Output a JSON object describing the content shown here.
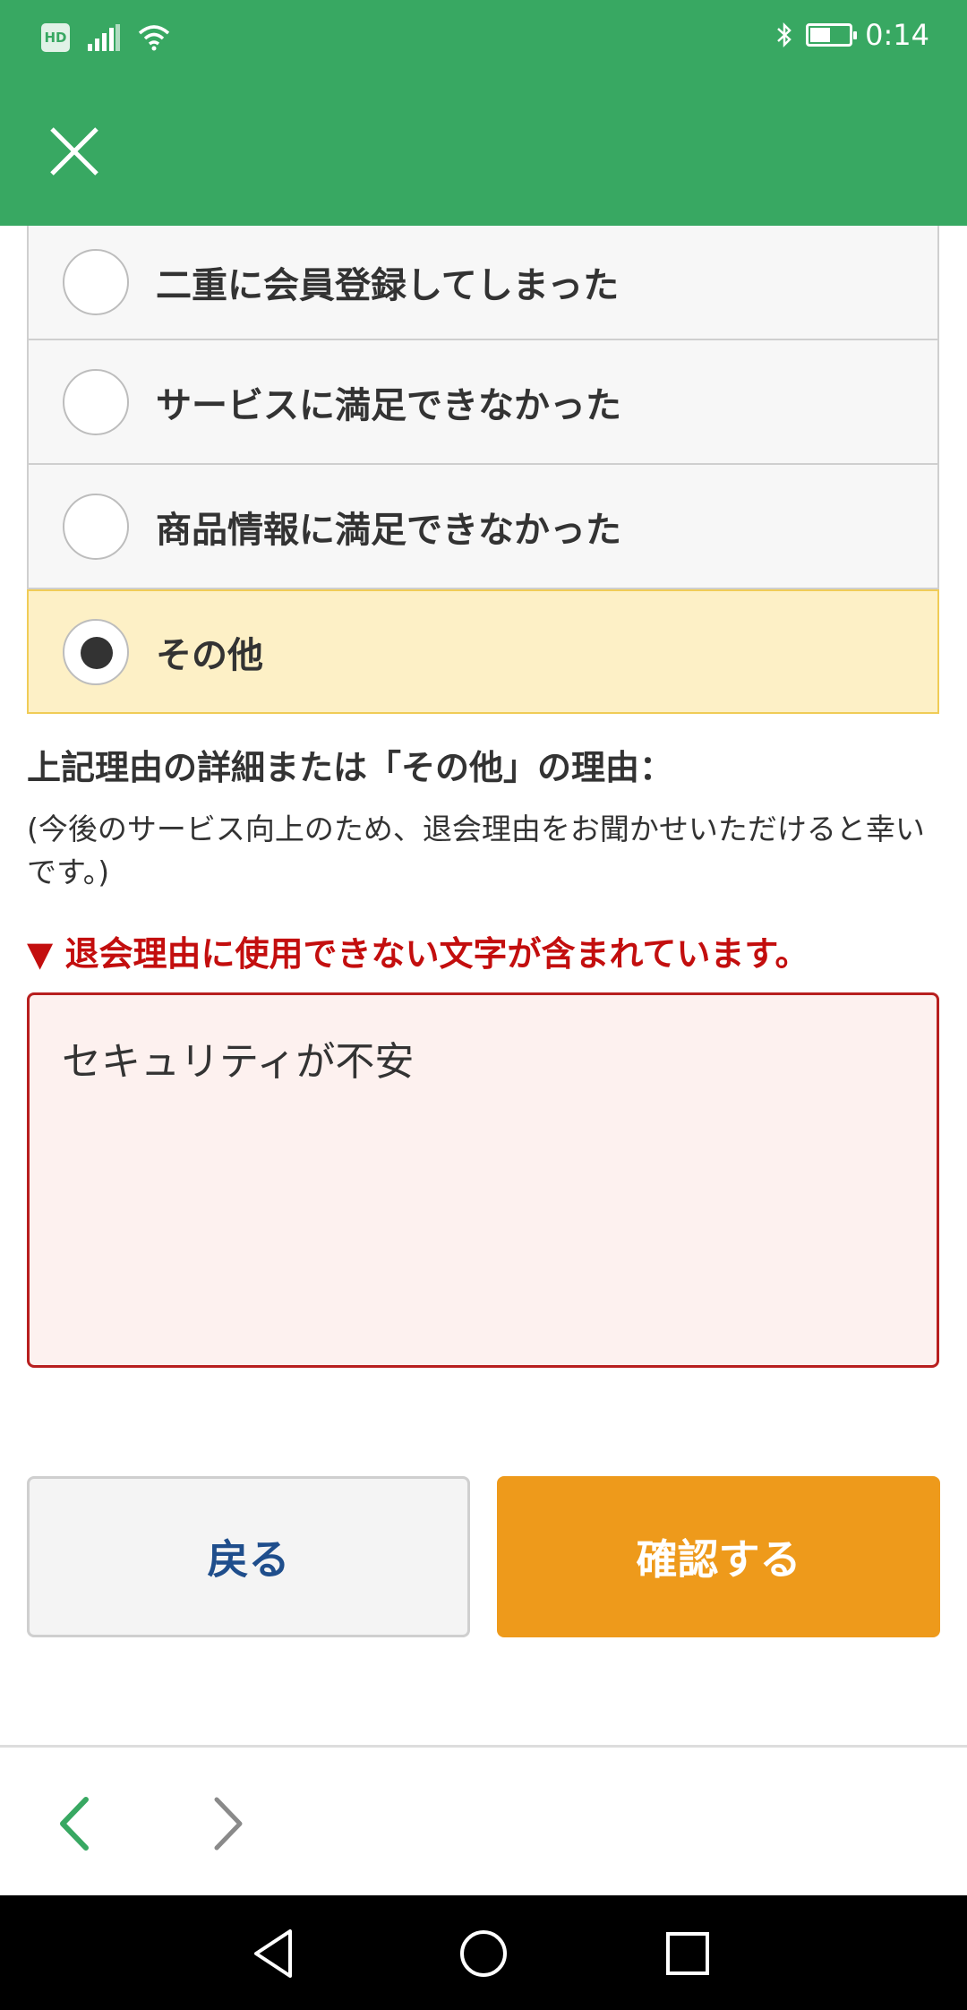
{
  "status_bar": {
    "hd": "HD",
    "time": "0:14"
  },
  "radio_options": [
    {
      "label": "二重に会員登録してしまった",
      "selected": false
    },
    {
      "label": "サービスに満足できなかった",
      "selected": false
    },
    {
      "label": "商品情報に満足できなかった",
      "selected": false
    },
    {
      "label": "その他",
      "selected": true
    }
  ],
  "detail": {
    "title": "上記理由の詳細または「その他」の理由：",
    "note": "(今後のサービス向上のため、退会理由をお聞かせいただけると幸いです。)"
  },
  "error": {
    "message": "▼ 退会理由に使用できない文字が含まれています。"
  },
  "reason_input": {
    "value": "セキュリティが不安"
  },
  "buttons": {
    "back": "戻る",
    "confirm": "確認する"
  },
  "colors": {
    "header_green": "#38a862",
    "selected_bg": "#fdf0c6",
    "error_red": "#c30e0e",
    "confirm_orange": "#ee9a1b",
    "back_text_blue": "#1f4e8c"
  },
  "icons": {
    "close": "close-icon",
    "browser_back": "chevron-left-icon",
    "browser_forward": "chevron-right-icon",
    "sys_back": "triangle-back-icon",
    "sys_home": "circle-home-icon",
    "sys_recent": "square-recent-icon"
  }
}
